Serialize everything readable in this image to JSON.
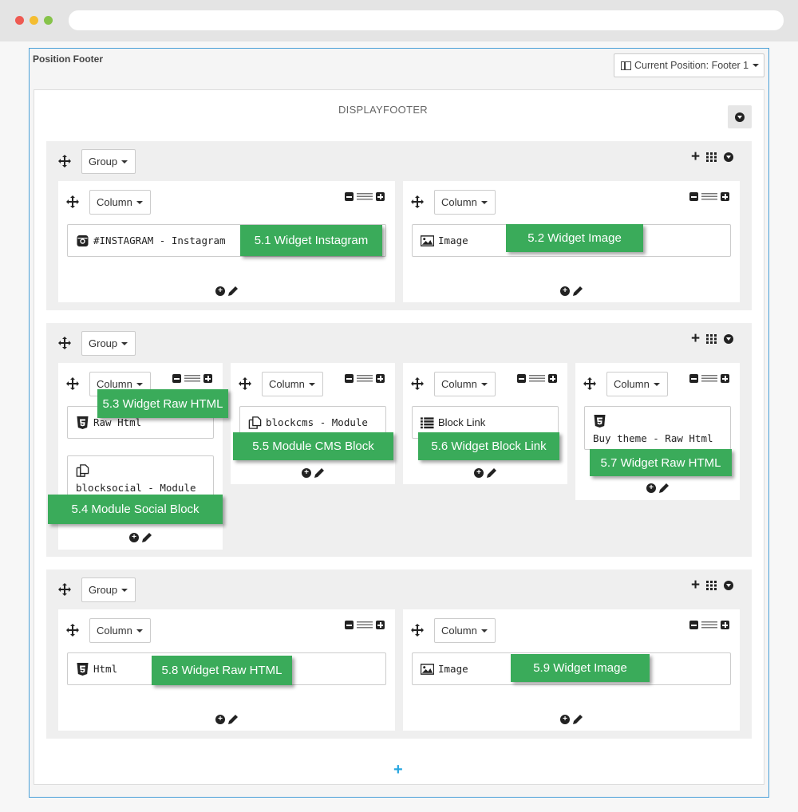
{
  "panel": {
    "title": "Position Footer",
    "position_button": "Current Position: Footer 1",
    "hook_title": "DISPLAYFOOTER",
    "add_group_symbol": "+"
  },
  "labels": {
    "group": "Group",
    "column": "Column"
  },
  "widgets": {
    "w1": "#INSTAGRAM - Instagram",
    "w2": "Image",
    "w3": "Raw Html",
    "w4": "blocksocial - Module",
    "w5": "blockcms - Module",
    "w6": "Block Link",
    "w7": "Buy theme - Raw Html",
    "w8": "Html",
    "w9": "Image"
  },
  "callouts": {
    "c1": "5.1 Widget Instagram",
    "c2": "5.2 Widget Image",
    "c3": "5.3 Widget Raw HTML",
    "c4": "5.4 Module Social Block",
    "c5": "5.5 Module CMS Block",
    "c6": "5.6 Widget Block Link",
    "c7": "5.7 Widget Raw HTML",
    "c8": "5.8 Widget Raw HTML",
    "c9": "5.9 Widget Image"
  },
  "colors": {
    "callout": "#3aab5a",
    "panel_border": "#4aa0d8",
    "add_group": "#28a7e0"
  },
  "icons": {
    "move": "move-arrows-icon",
    "instagram": "instagram-icon",
    "image": "image-icon",
    "html5": "html5-icon",
    "module": "module-copy-icon",
    "list": "list-icon"
  }
}
